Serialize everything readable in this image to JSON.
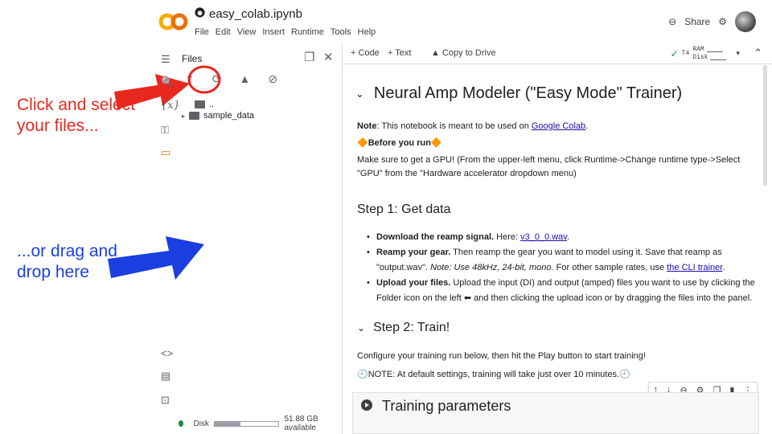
{
  "annotations": {
    "click_text": "Click and select your files...",
    "drag_text": "...or drag and drop here",
    "red_color": "#e8281e",
    "blue_color": "#1a3fe0"
  },
  "header": {
    "logo": "CO",
    "github_icon": "github-icon",
    "title": "easy_colab.ipynb",
    "menu": [
      "File",
      "Edit",
      "View",
      "Insert",
      "Runtime",
      "Tools",
      "Help"
    ],
    "share_label": "Share"
  },
  "files_panel": {
    "title": "Files",
    "tree": [
      {
        "label": ".."
      },
      {
        "label": "sample_data"
      }
    ],
    "disk_label": "Disk",
    "disk_usage": 0.4,
    "disk_available": "51.88 GB available"
  },
  "toolbar": {
    "code_label": "+ Code",
    "text_label": "+ Text",
    "copy_label": "Copy to Drive",
    "gpu_label": "T4",
    "ram_label": "RAM",
    "disk_label": "Disk"
  },
  "notebook": {
    "heading": "Neural Amp Modeler (\"Easy Mode\" Trainer)",
    "note_bold": "Note",
    "note_text": ": This notebook is meant to be used on ",
    "note_link": "Google Colab",
    "note_end": ".",
    "before_run": "🔶Before you run🔶",
    "gpu_text": "Make sure to get a GPU! (From the upper-left menu, click Runtime->Change runtime type->Select \"GPU\" from the \"Hardware accelerator dropdown menu)",
    "step1": "Step 1: Get data",
    "bullets": [
      {
        "bold": "Download the reamp signal.",
        "text": " Here: ",
        "link": "v3_0_0.wav",
        "end": "."
      },
      {
        "bold": "Reamp your gear.",
        "text": " Then reamp the gear you want to model using it. Save that reamp as \"output.wav\". ",
        "italic": "Note: Use 48kHz, 24-bit, mono.",
        "text2": " For other sample rates, use ",
        "link": "the CLI trainer",
        "end": "."
      },
      {
        "bold": "Upload your files.",
        "text": " Upload the input (DI) and output (amped) files you want to use by clicking the Folder icon on the left ⬅ and then clicking the upload icon or by dragging the files into the panel."
      }
    ],
    "step2": "Step 2: Train!",
    "configure_text": "Configure your training run below, then hit the Play button to start training!",
    "note_time": "🕘NOTE: At default settings, training will take just over 10 minutes.🕘",
    "cell_title": "Training parameters"
  }
}
